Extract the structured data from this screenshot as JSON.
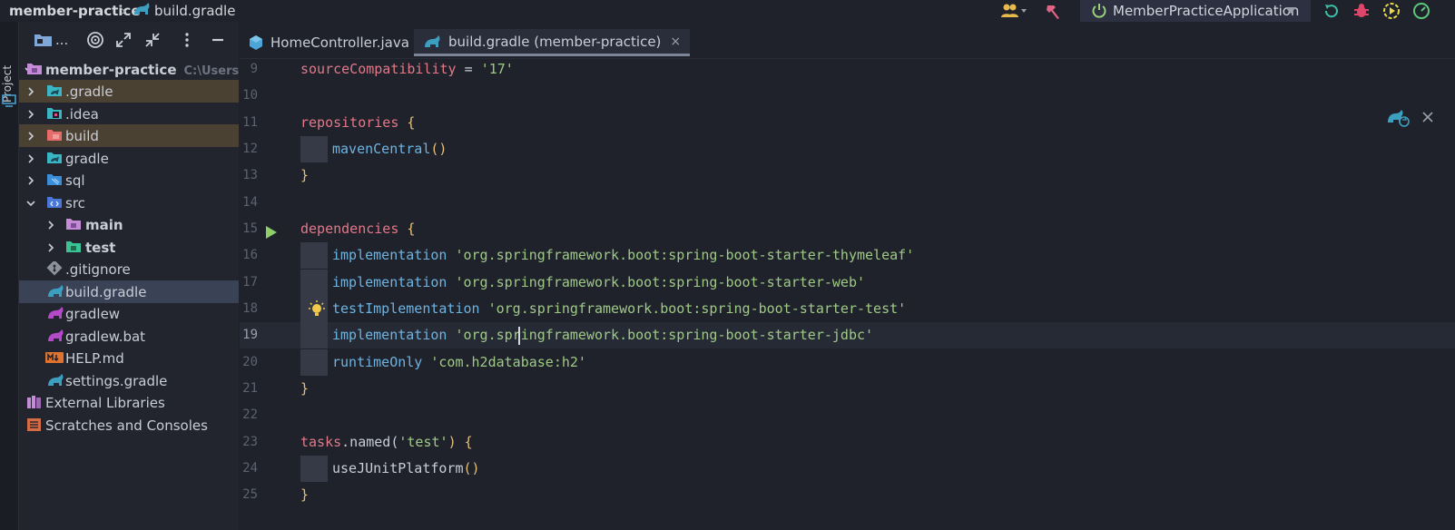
{
  "breadcrumb": {
    "project": "member-practice",
    "separator": "›",
    "file": "build.gradle"
  },
  "toolbar": {
    "run_config": "MemberPracticeApplication"
  },
  "side_stripe": {
    "label": "Project"
  },
  "project_panel": {
    "toolbar_dots": "..."
  },
  "tree": {
    "root": {
      "label": "member-practice",
      "path": "C:\\Users\\hy"
    },
    "items": [
      {
        "label": ".gradle"
      },
      {
        "label": ".idea"
      },
      {
        "label": "build"
      },
      {
        "label": "gradle"
      },
      {
        "label": "sql"
      },
      {
        "label": "src"
      },
      {
        "label": "main"
      },
      {
        "label": "test"
      },
      {
        "label": ".gitignore"
      },
      {
        "label": "build.gradle"
      },
      {
        "label": "gradlew"
      },
      {
        "label": "gradlew.bat"
      },
      {
        "label": "HELP.md"
      },
      {
        "label": "settings.gradle"
      },
      {
        "label": "External Libraries"
      },
      {
        "label": "Scratches and Consoles"
      }
    ]
  },
  "tabs": [
    {
      "label": "HomeController.java",
      "close": "×"
    },
    {
      "label": "build.gradle (member-practice)",
      "close": "×"
    }
  ],
  "editor": {
    "lines": [
      {
        "num": "9"
      },
      {
        "num": "10"
      },
      {
        "num": "11"
      },
      {
        "num": "12"
      },
      {
        "num": "13"
      },
      {
        "num": "14"
      },
      {
        "num": "15"
      },
      {
        "num": "16"
      },
      {
        "num": "17"
      },
      {
        "num": "18"
      },
      {
        "num": "19"
      },
      {
        "num": "20"
      },
      {
        "num": "21"
      },
      {
        "num": "22"
      },
      {
        "num": "23"
      },
      {
        "num": "24"
      },
      {
        "num": "25"
      }
    ],
    "tokens": {
      "l9_a": "sourceCompatibility",
      "l9_b": " = ",
      "l9_c": "'17'",
      "l11_a": "repositories",
      "l11_b": " {",
      "l12_a": "mavenCentral",
      "l12_b": "()",
      "l13_a": "}",
      "l15_a": "dependencies",
      "l15_b": " {",
      "l16_a": "implementation",
      "l16_b": " 'org.springframework.boot:spring-boot-starter-thymeleaf'",
      "l17_a": "implementation",
      "l17_b": " 'org.springframework.boot:spring-boot-starter-web'",
      "l18_a": "testImplementation",
      "l18_b": " 'org.springframework.boot:spring-boot-starter-test'",
      "l19_a": "implementation",
      "l19_b": " 'org.springframework.boot:spring-boot-starter-jdbc'",
      "l20_a": "runtimeOnly",
      "l20_b": " 'com.h2database:h2'",
      "l21_a": "}",
      "l23_a": "tasks",
      "l23_b": ".named(",
      "l23_c": "'test'",
      "l23_d": ") {",
      "l24_a": "useJUnitPlatform",
      "l24_b": "()",
      "l25_a": "}"
    }
  },
  "colors": {
    "background": "#1f222b",
    "panel": "#22252e",
    "keyword": "#e27888",
    "string": "#9fca86",
    "method": "#6fb3e0",
    "brace": "#e6c07b"
  }
}
